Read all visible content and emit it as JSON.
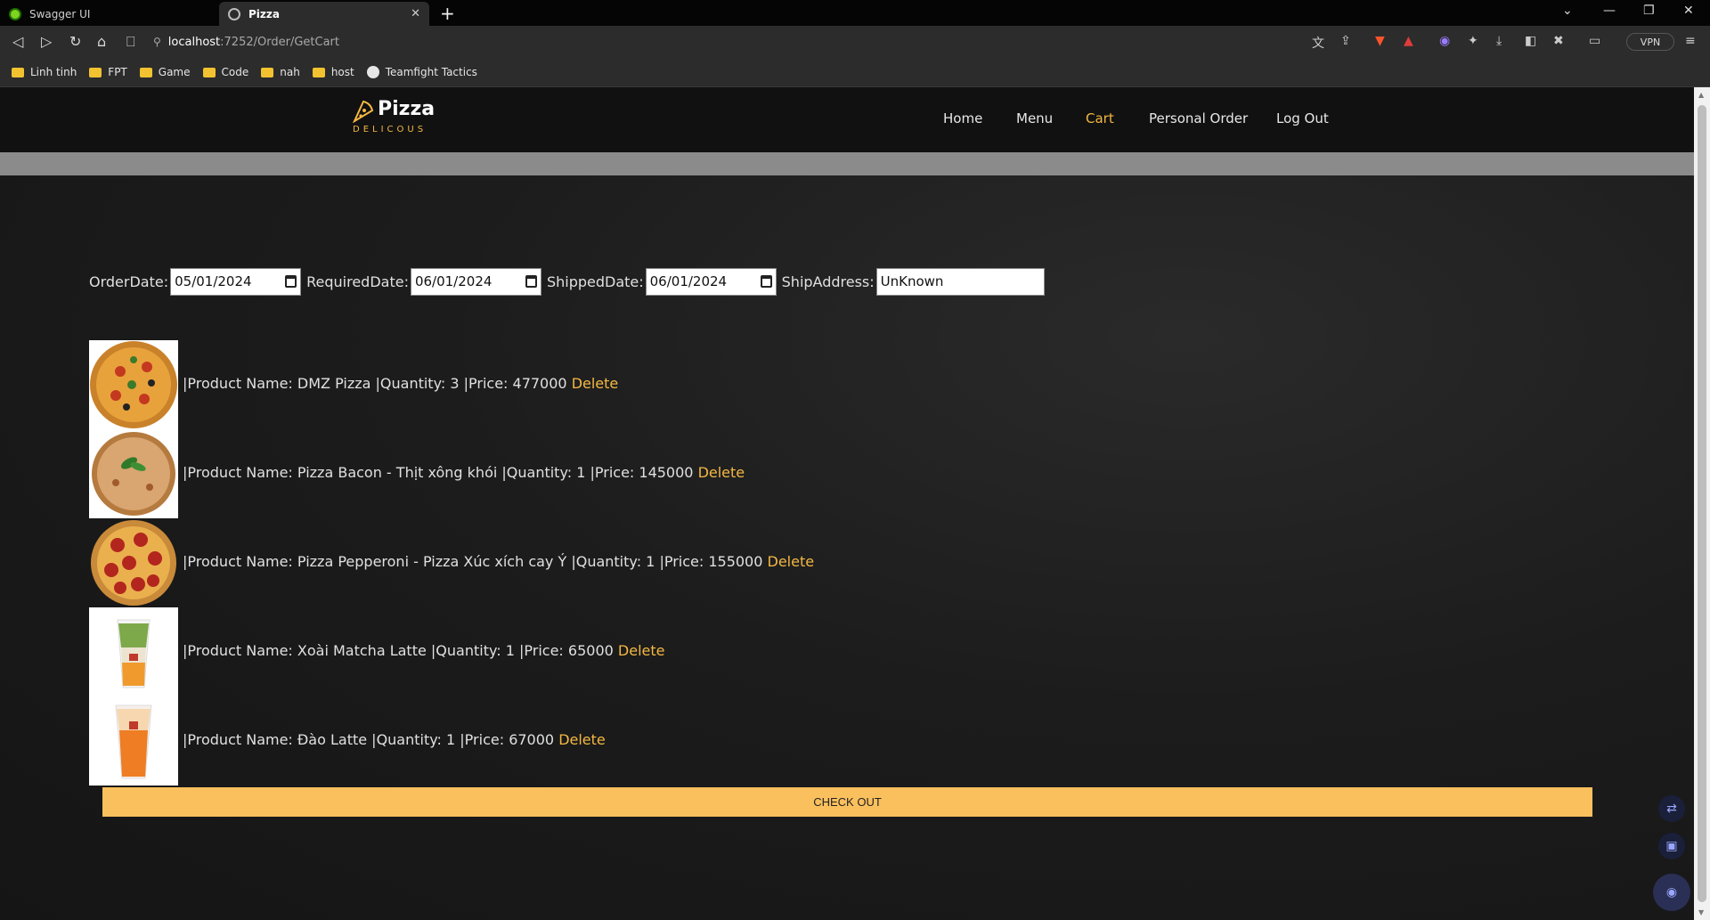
{
  "browser": {
    "tabs": [
      {
        "title": "Swagger UI",
        "active": false
      },
      {
        "title": "Pizza",
        "active": true
      }
    ],
    "url_host": "localhost",
    "url_path": ":7252/Order/GetCart",
    "vpn_label": "VPN",
    "bookmarks": [
      {
        "label": "Linh tinh",
        "icon": "folder-icon"
      },
      {
        "label": "FPT",
        "icon": "folder-icon"
      },
      {
        "label": "Game",
        "icon": "folder-icon"
      },
      {
        "label": "Code",
        "icon": "folder-icon"
      },
      {
        "label": "nah",
        "icon": "folder-icon"
      },
      {
        "label": "host",
        "icon": "folder-icon"
      },
      {
        "label": "Teamfight Tactics",
        "icon": "tft-icon"
      }
    ]
  },
  "site": {
    "logo_name": "Pizza",
    "logo_tagline": "DELICOUS",
    "accent_color": "#f4b843",
    "nav": [
      {
        "label": "Home",
        "active": false
      },
      {
        "label": "Menu",
        "active": false
      },
      {
        "label": "Cart",
        "active": true
      },
      {
        "label": "Personal Order",
        "active": false
      },
      {
        "label": "Log Out",
        "active": false
      }
    ]
  },
  "form": {
    "order_date_label": "OrderDate:",
    "order_date": "05/01/2024",
    "required_date_label": "RequiredDate:",
    "required_date": "06/01/2024",
    "shipped_date_label": "ShippedDate:",
    "shipped_date": "06/01/2024",
    "ship_address_label": "ShipAddress:",
    "ship_address": "UnKnown"
  },
  "cart": {
    "items": [
      {
        "text": "|Product Name: DMZ Pizza |Quantity: 3 |Price: 477000",
        "delete": "Delete",
        "image": "pizza-veggie"
      },
      {
        "text": "|Product Name: Pizza Bacon - Thịt xông khói |Quantity: 1 |Price: 145000",
        "delete": "Delete",
        "image": "pizza-bacon"
      },
      {
        "text": "|Product Name: Pizza Pepperoni - Pizza Xúc xích cay Ý |Quantity: 1 |Price: 155000",
        "delete": "Delete",
        "image": "pizza-pepperoni"
      },
      {
        "text": "|Product Name: Xoài Matcha Latte |Quantity: 1 |Price: 65000",
        "delete": "Delete",
        "image": "drink-matcha"
      },
      {
        "text": "|Product Name: Đào Latte |Quantity: 1 |Price: 67000",
        "delete": "Delete",
        "image": "drink-peach"
      }
    ],
    "checkout_label": "CHECK OUT"
  }
}
